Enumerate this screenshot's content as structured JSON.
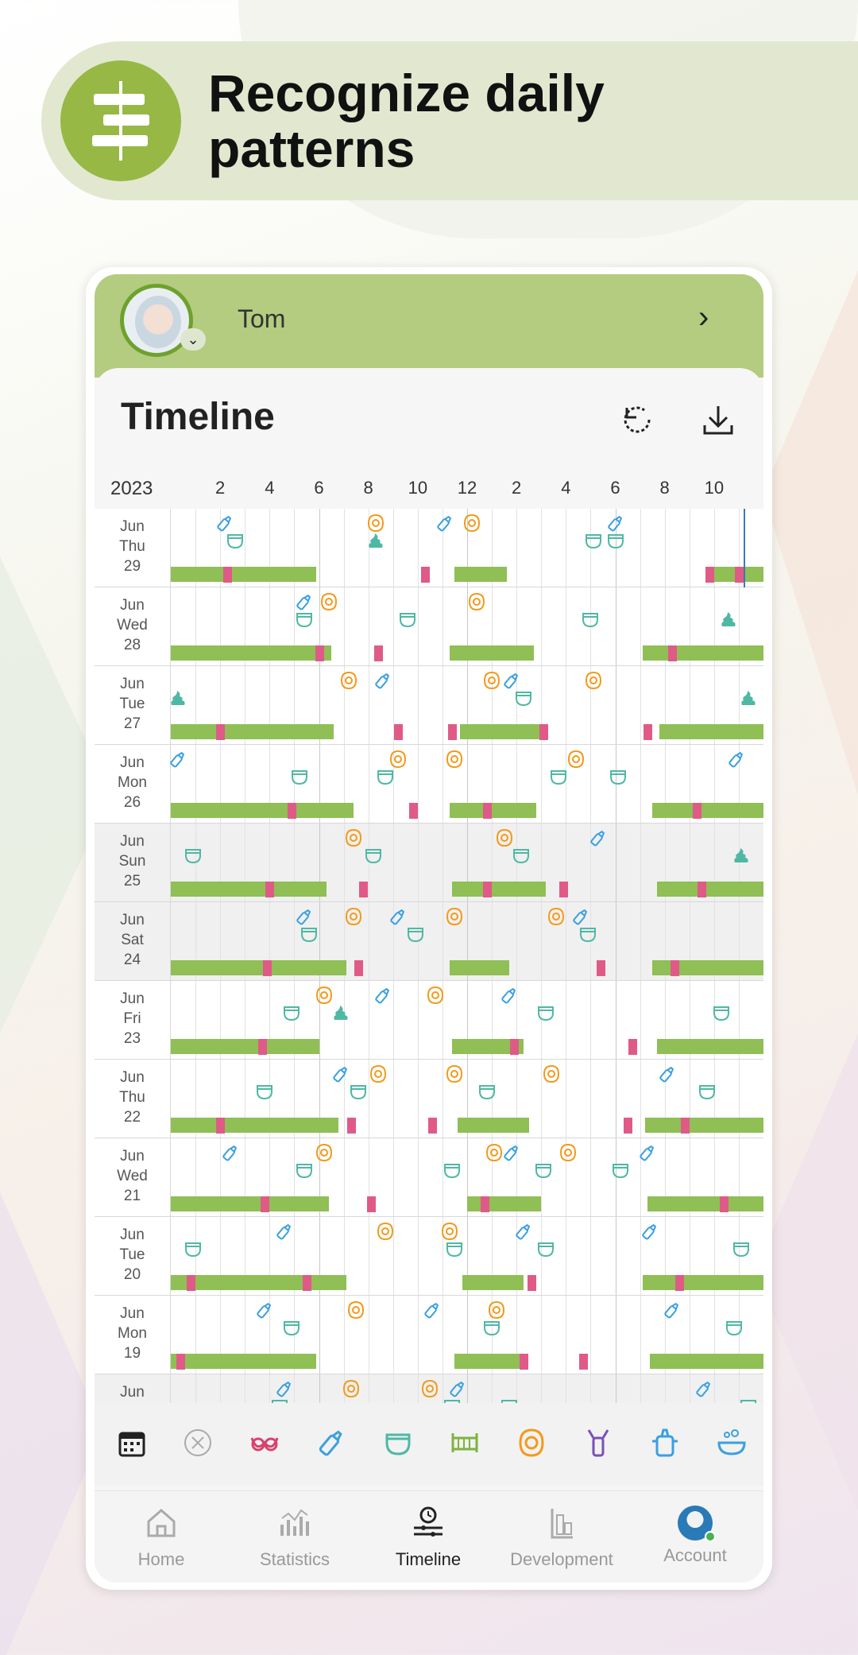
{
  "banner": {
    "title": "Recognize daily patterns",
    "icon": "timeline-icon"
  },
  "header": {
    "baby_name": "Tom"
  },
  "timeline": {
    "title": "Timeline",
    "year": "2023",
    "hour_labels": [
      "2",
      "4",
      "6",
      "8",
      "10",
      "12",
      "2",
      "4",
      "6",
      "8",
      "10"
    ]
  },
  "days": [
    {
      "month": "Jun",
      "weekday": "Thu",
      "date": "29"
    },
    {
      "month": "Jun",
      "weekday": "Wed",
      "date": "28"
    },
    {
      "month": "Jun",
      "weekday": "Tue",
      "date": "27"
    },
    {
      "month": "Jun",
      "weekday": "Mon",
      "date": "26"
    },
    {
      "month": "Jun",
      "weekday": "Sun",
      "date": "25"
    },
    {
      "month": "Jun",
      "weekday": "Sat",
      "date": "24"
    },
    {
      "month": "Jun",
      "weekday": "Fri",
      "date": "23"
    },
    {
      "month": "Jun",
      "weekday": "Thu",
      "date": "22"
    },
    {
      "month": "Jun",
      "weekday": "Wed",
      "date": "21"
    },
    {
      "month": "Jun",
      "weekday": "Tue",
      "date": "20"
    },
    {
      "month": "Jun",
      "weekday": "Mon",
      "date": "19"
    },
    {
      "month": "Jun",
      "weekday": "",
      "date": ""
    }
  ],
  "filters": [
    "calendar-icon",
    "clear-icon",
    "nursing-icon",
    "bottle-icon",
    "diaper-icon",
    "sleep-icon",
    "food-icon",
    "pump-icon",
    "sippy-cup-icon",
    "bath-icon"
  ],
  "colors": {
    "sleep": "#8fbf55",
    "wake": "#e05a87",
    "bottle": "#3aa0e0",
    "diaper": "#4fb8a4",
    "food": "#f39a1c",
    "header": "#b3cc80"
  },
  "nav": [
    {
      "label": "Home",
      "icon": "home-icon"
    },
    {
      "label": "Statistics",
      "icon": "statistics-icon"
    },
    {
      "label": "Timeline",
      "icon": "timeline-icon"
    },
    {
      "label": "Development",
      "icon": "development-icon"
    },
    {
      "label": "Account",
      "icon": "account-avatar"
    }
  ]
}
